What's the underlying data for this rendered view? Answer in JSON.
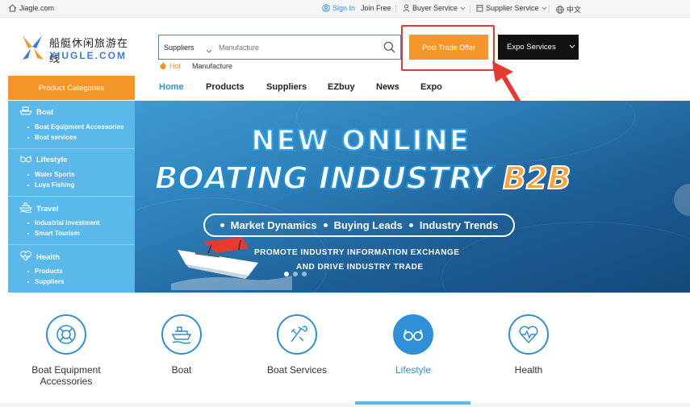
{
  "topbar": {
    "site": "Jiagle.com",
    "sign_in": "Sign In",
    "join": "Join Free",
    "buyer_service": "Buyer Service",
    "supplier_service": "Supplier Service",
    "language": "中文"
  },
  "logo": {
    "cn": "船艇休闲旅游在线",
    "en": "XIUGLE.COM"
  },
  "search": {
    "category": "Suppliers",
    "placeholder": "Manufacture"
  },
  "hot": {
    "label": "Hot",
    "keyword": "Manufacture"
  },
  "buttons": {
    "post_trade_offer": "Post Trade Offer",
    "expo_services": "Expo Services"
  },
  "product_categories": "Product Categories",
  "nav": {
    "tabs": [
      {
        "label": "Home",
        "active": true
      },
      {
        "label": "Products"
      },
      {
        "label": "Suppliers"
      },
      {
        "label": "EZbuy"
      },
      {
        "label": "News"
      },
      {
        "label": "Expo"
      }
    ]
  },
  "sidebar": {
    "categories": [
      {
        "title": "Boat",
        "icon": "boat-icon",
        "subs": [
          "Boat Equipment Accessories",
          "Boat services"
        ]
      },
      {
        "title": "Lifestyle",
        "icon": "glasses-icon",
        "subs": [
          "Water Sports",
          "Luya Fishing"
        ]
      },
      {
        "title": "Travel",
        "icon": "ship-icon",
        "subs": [
          "Industrial Investment",
          "Smart Tourism"
        ]
      },
      {
        "title": "Health",
        "icon": "heart-pulse-icon",
        "subs": [
          "Products",
          "Suppliers"
        ]
      }
    ]
  },
  "banner": {
    "title1": "NEW ONLINE",
    "title2_main": "BOATING INDUSTRY",
    "title2_accent": "B2B",
    "pill": [
      "Market Dynamics",
      "Buying Leads",
      "Industry Trends"
    ],
    "promo1": "PROMOTE INDUSTRY INFORMATION EXCHANGE",
    "promo2": "AND DRIVE INDUSTRY TRADE"
  },
  "category_strip": [
    {
      "label": "Boat Equipment Accessories",
      "icon": "lifebuoy-icon"
    },
    {
      "label": "Boat",
      "icon": "ship-icon"
    },
    {
      "label": "Boat Services",
      "icon": "tools-icon"
    },
    {
      "label": "Lifestyle",
      "icon": "glasses-icon",
      "active": true
    },
    {
      "label": "Health",
      "icon": "heart-pulse-icon"
    }
  ],
  "colors": {
    "accent_blue": "#2f8fd8",
    "orange": "#f5962a",
    "sidebar_blue": "#5bb8ea",
    "highlight_red": "#e6392f"
  }
}
